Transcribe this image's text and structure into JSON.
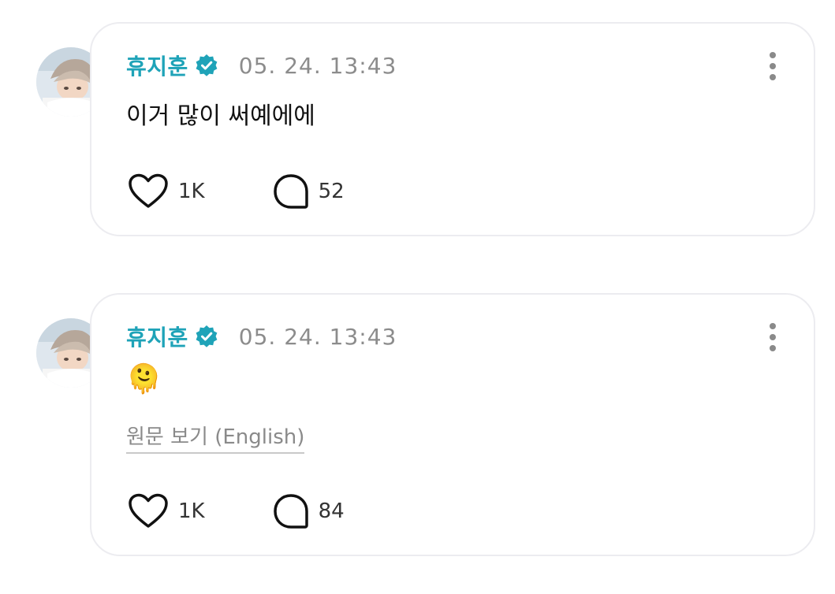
{
  "posts": [
    {
      "username": "휴지훈",
      "timestamp": "05. 24. 13:43",
      "text": "이거 많이 써예에에",
      "translate_link": "",
      "likes": "1K",
      "comments": "52"
    },
    {
      "username": "휴지훈",
      "timestamp": "05. 24. 13:43",
      "text": "🫠",
      "translate_link": "원문 보기 (English)",
      "likes": "1K",
      "comments": "84"
    }
  ],
  "colors": {
    "accent": "#1fa3b8",
    "timestamp": "#8c8c8c",
    "border": "#ececf0"
  },
  "icons": {
    "verified": "verified-badge-icon",
    "more": "more-vertical-icon",
    "like": "heart-icon",
    "comment": "comment-bubble-icon"
  }
}
